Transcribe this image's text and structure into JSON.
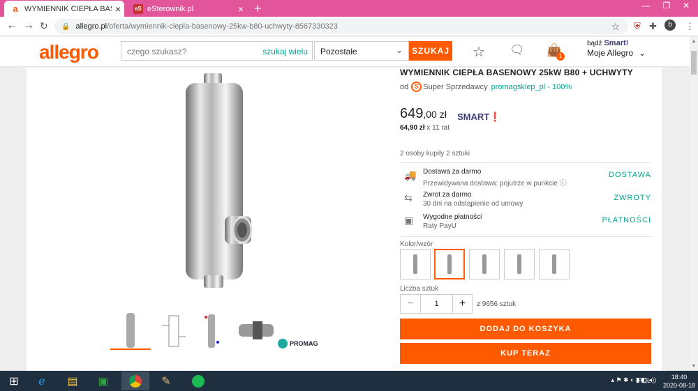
{
  "browser": {
    "tabs": [
      {
        "title": "WYMIENNIK CIEPŁA BASENOWY",
        "favicon": "a",
        "close": "×"
      },
      {
        "title": "eSterownik.pl",
        "favicon": "eS",
        "close": "×"
      }
    ],
    "new_tab": "+",
    "url_domain": "allegro.pl",
    "url_path": "/oferta/wymiennik-ciepla-basenowy-25kw-b80-uchwyty-8567330323",
    "profile_initial": "b",
    "tab_color": "#e2559a"
  },
  "header": {
    "logo": "allegro",
    "search_placeholder": "czego szukasz?",
    "search_many": "szukaj wielu",
    "category": "Pozostałe",
    "search_button": "SZUKAJ",
    "smart_prefix": "bądź",
    "smart_word": "Smart!",
    "my_allegro": "Moje Allegro",
    "cart_count": "1",
    "accent": "#ff5a00",
    "link_color": "#00a790"
  },
  "product": {
    "title": "WYMIENNIK CIEPŁA BASENOWY 25kW B80 + UCHWYTY",
    "seller_prefix": "od",
    "seller_type": "Super Sprzedawcy",
    "seller_name": "promagsklep_pl - 100%",
    "price_main": "649",
    "price_rest": ",00 zł",
    "smart_logo": "SMART",
    "installment_amount": "64,90 zł",
    "installment_rest": "x 11 rat",
    "bought": "2 osoby kupiły 2 sztuki",
    "delivery": {
      "title": "Dostawa za darmo",
      "sub": "Przewidywana dostawa: pojutrze w punkcie ⓘ",
      "link": "DOSTAWA"
    },
    "returns": {
      "title": "Zwrot za darmo",
      "sub": "30 dni na odstąpienie od umowy",
      "link": "ZWROTY"
    },
    "payments": {
      "title": "Wygodne płatności",
      "sub": "Raty PayU",
      "link": "PŁATNOŚCI"
    },
    "color_label": "Kolor/wzór",
    "qty_label": "Liczba sztuk",
    "qty_value": "1",
    "qty_minus": "−",
    "qty_plus": "+",
    "qty_of": "z 9656 sztuk",
    "add_to_cart": "DODAJ DO KOSZYKA",
    "buy_now": "KUP TERAZ",
    "promag_thumb": "PROMAG"
  },
  "taskbar": {
    "lang": "POL",
    "time": "18:40",
    "date": "2020-08-18"
  }
}
